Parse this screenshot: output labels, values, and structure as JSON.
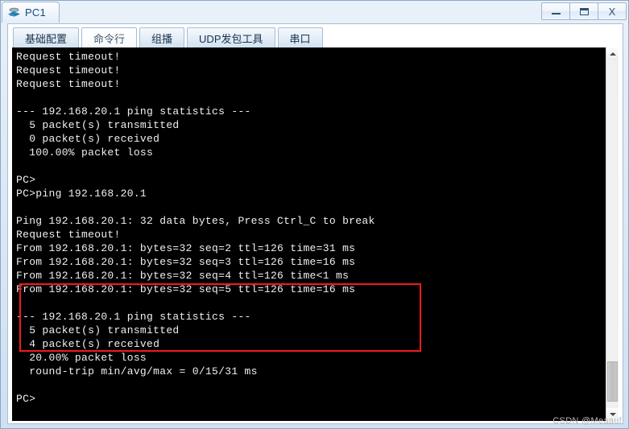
{
  "window": {
    "title": "PC1",
    "icon": "router-pc-icon",
    "controls": {
      "minimize": "–",
      "maximize": "❐",
      "close": "X"
    }
  },
  "tabs": [
    {
      "label": "基础配置",
      "active": false,
      "name": "tab-basic-config"
    },
    {
      "label": "命令行",
      "active": true,
      "name": "tab-command-line"
    },
    {
      "label": "组播",
      "active": false,
      "name": "tab-multicast"
    },
    {
      "label": "UDP发包工具",
      "active": false,
      "name": "tab-udp-tool"
    },
    {
      "label": "串口",
      "active": false,
      "name": "tab-serial-port"
    }
  ],
  "terminal": {
    "lines": [
      "Request timeout!",
      "Request timeout!",
      "Request timeout!",
      "",
      "--- 192.168.20.1 ping statistics ---",
      "  5 packet(s) transmitted",
      "  0 packet(s) received",
      "  100.00% packet loss",
      "",
      "PC>",
      "PC>ping 192.168.20.1",
      "",
      "Ping 192.168.20.1: 32 data bytes, Press Ctrl_C to break",
      "Request timeout!",
      "From 192.168.20.1: bytes=32 seq=2 ttl=126 time=31 ms",
      "From 192.168.20.1: bytes=32 seq=3 ttl=126 time=16 ms",
      "From 192.168.20.1: bytes=32 seq=4 ttl=126 time<1 ms",
      "From 192.168.20.1: bytes=32 seq=5 ttl=126 time=16 ms",
      "",
      "--- 192.168.20.1 ping statistics ---",
      "  5 packet(s) transmitted",
      "  4 packet(s) received",
      "  20.00% packet loss",
      "  round-trip min/avg/max = 0/15/31 ms",
      "",
      "PC>"
    ]
  },
  "annotation": {
    "color": "#f41a1a",
    "label": "highlight-rectangle"
  },
  "scrollbar": {
    "up_arrow": "scroll-up-icon",
    "down_arrow": "scroll-down-icon"
  },
  "watermark": {
    "text": "CSDN @Meaauf"
  }
}
